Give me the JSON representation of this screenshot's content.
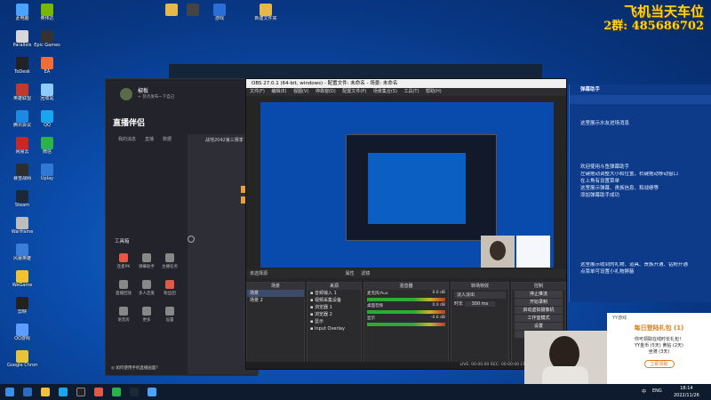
{
  "desktop": {
    "icons": [
      {
        "label": "此电脑",
        "color": "#4aa3ff"
      },
      {
        "label": "Parallels",
        "color": "#d8d8d8"
      },
      {
        "label": "ToDesk",
        "color": "#222"
      },
      {
        "label": "英雄联盟",
        "color": "#c0392b"
      },
      {
        "label": "腾讯会议",
        "color": "#1e88e5"
      },
      {
        "label": "网易云",
        "color": "#c62828"
      },
      {
        "label": "暴雪战网",
        "color": "#2d2d2d"
      },
      {
        "label": "Steam",
        "color": "#1b2838"
      },
      {
        "label": "Warframe",
        "color": "#bdbdbd"
      },
      {
        "label": "风暴英雄",
        "color": "#3b7dd8"
      },
      {
        "label": "WeGame",
        "color": "#f2c230"
      },
      {
        "label": "剪映",
        "color": "#222"
      },
      {
        "label": "QQ游戏",
        "color": "#5e9cff"
      },
      {
        "label": "Google Chrome",
        "color": "#e8c23a"
      },
      {
        "label": "英伟达",
        "color": "#76b900"
      },
      {
        "label": "Epic Games",
        "color": "#333"
      },
      {
        "label": "EA",
        "color": "#f16c37"
      },
      {
        "label": "回收站",
        "color": "#8ecbff"
      },
      {
        "label": "QQ",
        "color": "#1aa6ee"
      },
      {
        "label": "微信",
        "color": "#2bb24c"
      },
      {
        "label": "Uplay",
        "color": "#3079d6"
      }
    ],
    "shortcut_labels": [
      "新建文件夹",
      "游戏"
    ],
    "banner_line1": "飞机当天车位",
    "banner_line2": "2群: 485686702"
  },
  "side_panel": {
    "header": "弹幕助手",
    "lines": [
      "这里展示水友进场消息",
      "欢迎使用斗鱼弹幕助手",
      "左键拖动调整大小和位置，右键拖动移动窗口",
      "在上角有设置菜单",
      "这里展示弹幕、贵族信息、和战绩等",
      "添加弹幕助手成功",
      "这里展示收到的礼物、道具、贵族开通、钻粉开通",
      "点菜单可设置小礼物屏蔽"
    ]
  },
  "streamer_app": {
    "title": "直播伴侣",
    "user_name": "椒板",
    "user_sub": "+ 装点发布一下自己",
    "tabs": [
      "我的消息",
      "直播",
      "数据"
    ],
    "game_tab": "战地2042第三赛季",
    "toolbox_label": "工具箱",
    "tools": [
      {
        "label": "连麦PK",
        "color": "#e05a47",
        "icon": "pk-icon"
      },
      {
        "label": "弹幕助手",
        "color": "#888",
        "icon": "chat-icon"
      },
      {
        "label": "主播任务",
        "color": "#888",
        "icon": "task-icon"
      },
      {
        "label": "直播回放",
        "color": "#888",
        "icon": "replay-icon"
      },
      {
        "label": "多人连麦",
        "color": "#888",
        "icon": "multi-icon"
      },
      {
        "label": "粉丝团",
        "color": "#e05a47",
        "icon": "fans-icon"
      },
      {
        "label": "语音房",
        "color": "#888",
        "icon": "voice-icon"
      },
      {
        "label": "更多",
        "color": "#888",
        "icon": "more-icon"
      },
      {
        "label": "设置",
        "color": "#888",
        "icon": "settings-icon"
      }
    ],
    "bottom_link": "◎ 如何使用手机直播画面?"
  },
  "obs": {
    "title": "OBS 27.0.1 (64-bit, windows) - 配置文件: 未命名 - 场景: 未命名",
    "menu": [
      "文件(F)",
      "编辑(E)",
      "视图(V)",
      "停靠窗(D)",
      "配置文件(P)",
      "场景集合(S)",
      "工具(T)",
      "帮助(H)"
    ],
    "source_label": "未选择源",
    "props_label": "属性",
    "filters_label": "滤镜",
    "docks": {
      "scenes": {
        "header": "场景",
        "items": [
          "场景",
          "场景 2"
        ]
      },
      "sources": {
        "header": "来源",
        "items": [
          "音频输入 1",
          "视频采集设备",
          "浏览器 1",
          "浏览器 2",
          "显示",
          "Input Overlay"
        ]
      },
      "mixer": {
        "header": "混音器",
        "items": [
          "麦克风/Aux",
          "桌面音频",
          "显示"
        ],
        "levels": [
          "0.0 dB",
          "0.0 dB",
          "-0.6 dB"
        ]
      },
      "transitions": {
        "header": "转场特效",
        "type": "淡入淡出",
        "duration_label": "时长",
        "duration": "300 ms"
      },
      "controls": {
        "header": "控制",
        "buttons": [
          "停止推流",
          "开始录制",
          "启动虚拟摄像机",
          "工作室模式",
          "设置",
          "退出"
        ]
      }
    },
    "status": "LIVE: 00:00:00  REC: 00:00:00  CPU: 5.5%, 60.00 fps"
  },
  "notification": {
    "app": "YY游戏",
    "title": "每日登陆礼包 (1)",
    "body": "你可领取在线时长礼包！",
    "lines": [
      "YY金币 (5天)  黄钻 (2天)",
      "坐骑 (3天)"
    ],
    "button": "立即领取"
  },
  "taskbar": {
    "time": "18:14",
    "date": "2022/11/26",
    "lang": "ENG",
    "tray": "中"
  }
}
